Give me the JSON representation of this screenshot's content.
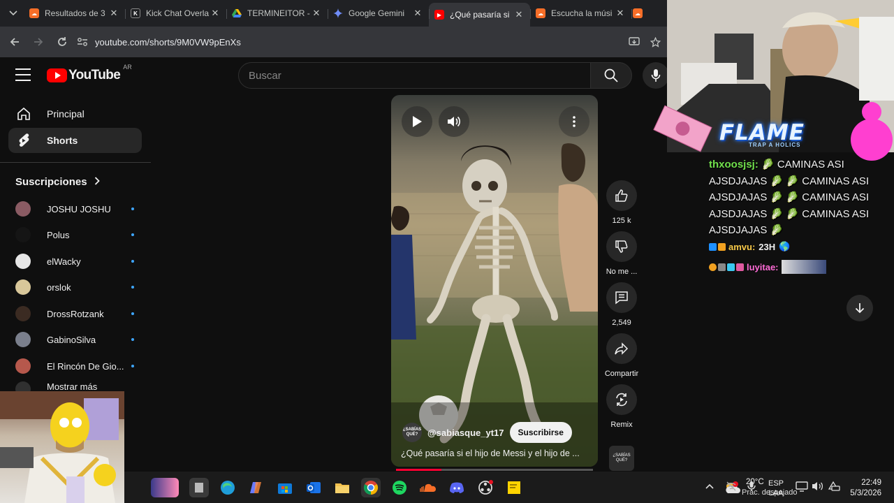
{
  "browser": {
    "tabs": [
      {
        "title": "Resultados de 3",
        "color": "#f76e28"
      },
      {
        "title": "Kick Chat Overla",
        "color": "#202124"
      },
      {
        "title": "TERMINEITOR -",
        "color": "#2e7d32"
      },
      {
        "title": "Google Gemini",
        "color": "#4f7cf7"
      },
      {
        "title": "¿Qué pasaría si",
        "color": "#ff0000",
        "active": true
      },
      {
        "title": "Escucha la músi",
        "color": "#f76e28"
      }
    ],
    "url": "youtube.com/shorts/9M0VW9pEnXs"
  },
  "youtube": {
    "logo_text": "YouTube",
    "country_code": "AR",
    "search_placeholder": "Buscar",
    "sidebar": {
      "nav": [
        {
          "label": "Principal",
          "icon": "home-icon"
        },
        {
          "label": "Shorts",
          "icon": "shorts-icon",
          "active": true
        }
      ],
      "subscriptions_title": "Suscripciones",
      "subscriptions": [
        {
          "name": "JOSHU JOSHU",
          "color": "#8a5b63"
        },
        {
          "name": "Polus",
          "color": "#151515"
        },
        {
          "name": "elWacky",
          "color": "#e6e6e6"
        },
        {
          "name": "orslok",
          "color": "#d8c79a"
        },
        {
          "name": "DrossRotzank",
          "color": "#3b2b22"
        },
        {
          "name": "GabinoSilva",
          "color": "#7a7f8c"
        },
        {
          "name": "El Rincón De Gio...",
          "color": "#b6584c"
        }
      ],
      "show_more": "Mostrar más"
    },
    "short": {
      "channel": "@sabiasque_yt17",
      "channel_avatar_text": "¿SABÍAS QUÉ?",
      "subscribe": "Suscribirse",
      "caption": "¿Qué pasaría si el hijo de Messi y el hijo de ...",
      "progress": 0.23
    },
    "actions": [
      {
        "label": "125 k",
        "icon": "like-icon"
      },
      {
        "label": "No me ...",
        "icon": "dislike-icon"
      },
      {
        "label": "2,549",
        "icon": "comments-icon"
      },
      {
        "label": "Compartir",
        "icon": "share-icon"
      },
      {
        "label": "Remix",
        "icon": "remix-icon"
      }
    ]
  },
  "overlay": {
    "flame_title": "FLAME",
    "flame_subtitle": "TRAP A HOLICS",
    "chat": {
      "user1": "thxoosjsj:",
      "message1": [
        "CAMINAS ASI",
        "AJSDJAJAS",
        "CAMINAS ASI",
        "AJSDJAJAS",
        "CAMINAS ASI",
        "AJSDJAJAS",
        "CAMINAS ASI",
        "AJSDJAJAS"
      ],
      "user2": "amvu:",
      "message2": "23H",
      "user3": "luyitae:"
    }
  },
  "taskbar": {
    "weather_temp": "20°C",
    "weather_desc": "Prac. despejado",
    "lang_top": "ESP",
    "lang_bottom": "LAA",
    "time": "22:49",
    "date": "5/3/2026"
  }
}
